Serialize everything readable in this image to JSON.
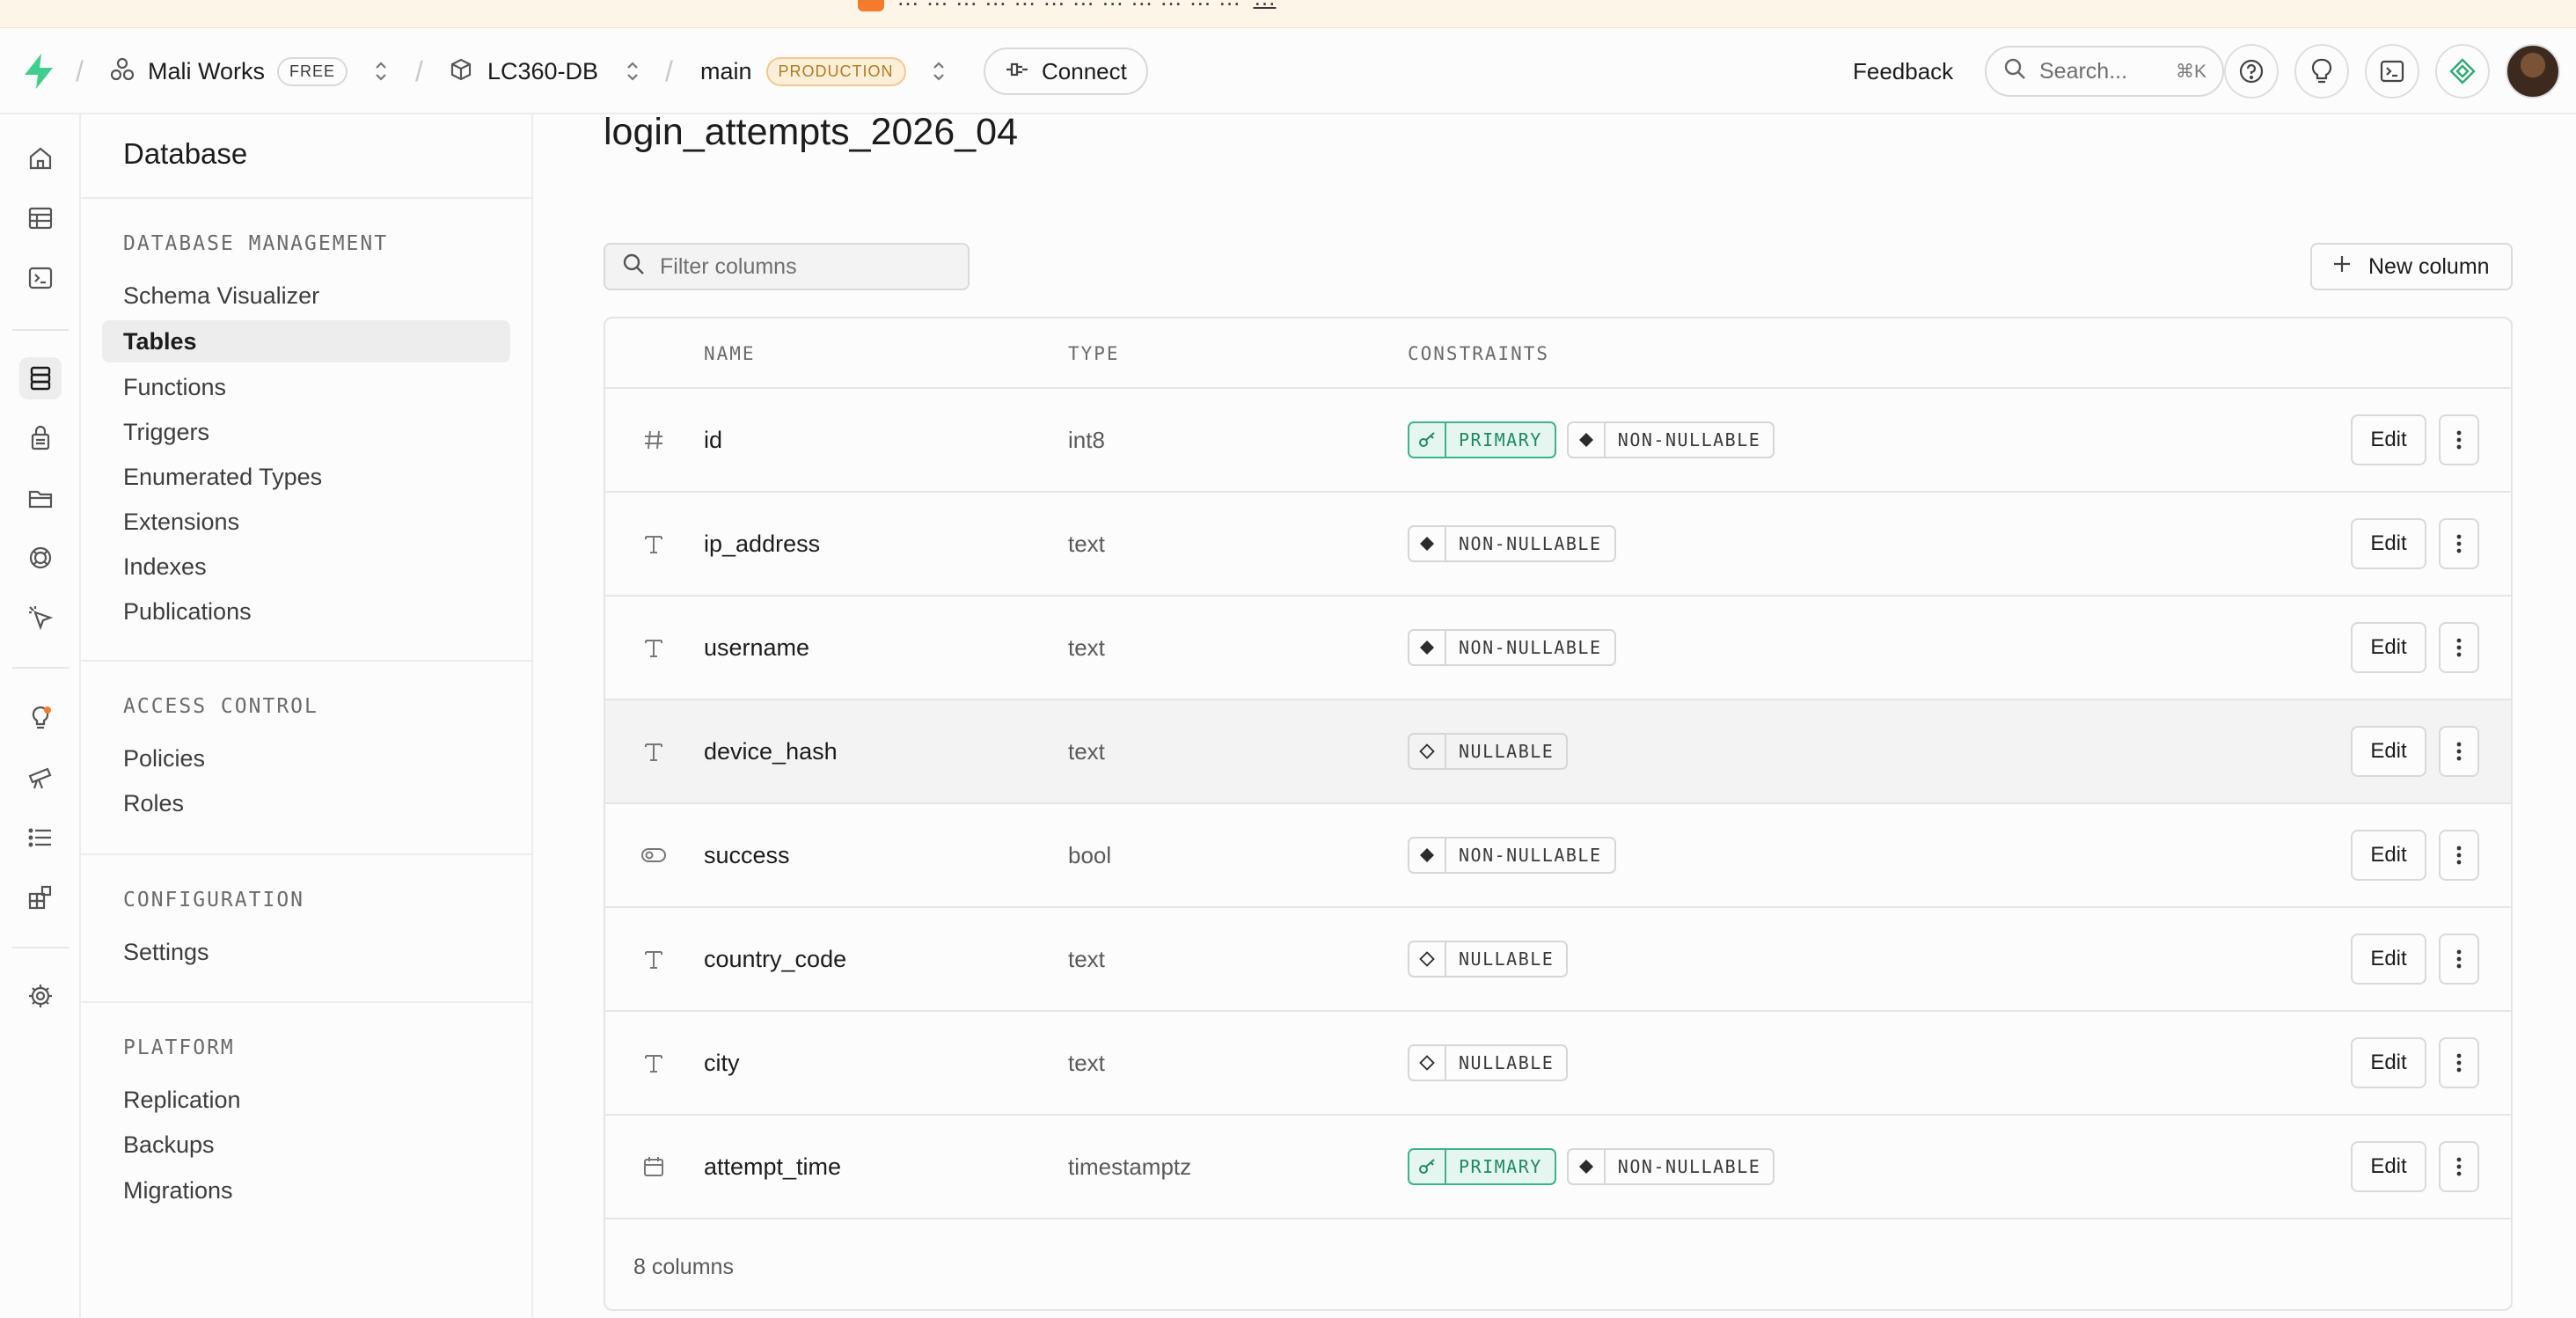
{
  "banner": {
    "text": "… … … … … … … … … … … …",
    "link": "…"
  },
  "topnav": {
    "org": "Mali Works",
    "org_plan": "FREE",
    "project": "LC360-DB",
    "branch": "main",
    "branch_env": "PRODUCTION",
    "connect_label": "Connect",
    "feedback_label": "Feedback",
    "search_placeholder": "Search...",
    "search_shortcut": "⌘K"
  },
  "rail": {
    "icons": [
      "home-icon",
      "table-editor-icon",
      "sql-editor-icon",
      "database-icon",
      "auth-icon",
      "storage-icon",
      "realtime-icon",
      "edge-functions-icon",
      "advisors-icon",
      "observability-icon",
      "logs-icon",
      "integrations-icon",
      "settings-icon"
    ]
  },
  "sidebar": {
    "title": "Database",
    "sections": [
      {
        "heading": "DATABASE MANAGEMENT",
        "items": [
          "Schema Visualizer",
          "Tables",
          "Functions",
          "Triggers",
          "Enumerated Types",
          "Extensions",
          "Indexes",
          "Publications"
        ]
      },
      {
        "heading": "ACCESS CONTROL",
        "items": [
          "Policies",
          "Roles"
        ]
      },
      {
        "heading": "CONFIGURATION",
        "items": [
          "Settings"
        ]
      },
      {
        "heading": "PLATFORM",
        "items": [
          "Replication",
          "Backups",
          "Migrations"
        ]
      }
    ],
    "active_item": "Tables"
  },
  "main": {
    "title": "login_attempts_2026_04",
    "filter_placeholder": "Filter columns",
    "new_column_label": "New column",
    "headers": {
      "name": "NAME",
      "type": "TYPE",
      "constraints": "CONSTRAINTS"
    },
    "edit_label": "Edit",
    "rows": [
      {
        "icon": "hash-icon",
        "name": "id",
        "type": "int8",
        "constraints": [
          "PRIMARY",
          "NON-NULLABLE"
        ]
      },
      {
        "icon": "text-type-icon",
        "name": "ip_address",
        "type": "text",
        "constraints": [
          "NON-NULLABLE"
        ]
      },
      {
        "icon": "text-type-icon",
        "name": "username",
        "type": "text",
        "constraints": [
          "NON-NULLABLE"
        ]
      },
      {
        "icon": "text-type-icon",
        "name": "device_hash",
        "type": "text",
        "constraints": [
          "NULLABLE"
        ]
      },
      {
        "icon": "toggle-icon",
        "name": "success",
        "type": "bool",
        "constraints": [
          "NON-NULLABLE"
        ]
      },
      {
        "icon": "text-type-icon",
        "name": "country_code",
        "type": "text",
        "constraints": [
          "NULLABLE"
        ]
      },
      {
        "icon": "text-type-icon",
        "name": "city",
        "type": "text",
        "constraints": [
          "NULLABLE"
        ]
      },
      {
        "icon": "calendar-icon",
        "name": "attempt_time",
        "type": "timestamptz",
        "constraints": [
          "PRIMARY",
          "NON-NULLABLE"
        ]
      }
    ],
    "footer_count": "8 columns"
  }
}
